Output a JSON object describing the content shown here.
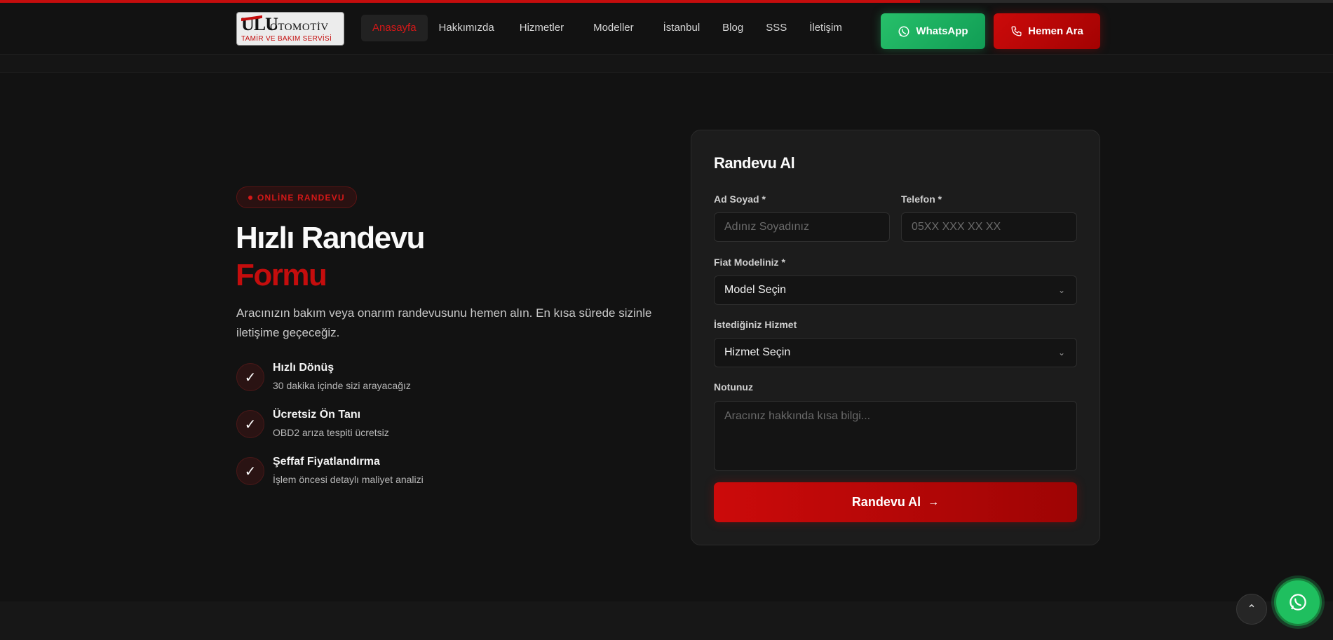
{
  "scroll_progress_percent": 69,
  "colors": {
    "accent": "#c40d0d",
    "whatsapp": "#1fbf5f",
    "background": "#121212"
  },
  "header": {
    "logo": {
      "mark": "ULU",
      "word": "OTOMOTİV",
      "subtitle": "TAMİR VE BAKIM SERVİSİ"
    },
    "nav": [
      {
        "label": "Anasayfa",
        "active": true
      },
      {
        "label": "Hakkımızda",
        "active": false
      },
      {
        "label": "Hizmetler",
        "active": false
      },
      {
        "label": "Modeller",
        "active": false
      },
      {
        "label": "İstanbul",
        "active": false
      },
      {
        "label": "Blog",
        "active": false
      },
      {
        "label": "SSS",
        "active": false
      },
      {
        "label": "İletişim",
        "active": false
      }
    ],
    "whatsapp_button": {
      "label": "WhatsApp",
      "icon": "whatsapp-icon"
    },
    "call_button": {
      "label": "Hemen Ara",
      "icon": "phone-icon"
    }
  },
  "hero": {
    "badge": "ONLİNE RANDEVU",
    "title_line1": "Hızlı Randevu",
    "title_line2": "Formu",
    "lead": "Aracınızın bakım veya onarım randevusunu hemen alın. En kısa sürede sizinle iletişime geçeceğiz.",
    "features": [
      {
        "title": "Hızlı Dönüş",
        "desc": "30 dakika içinde sizi arayacağız",
        "icon": "check-icon"
      },
      {
        "title": "Ücretsiz Ön Tanı",
        "desc": "OBD2 arıza tespiti ücretsiz",
        "icon": "check-icon"
      },
      {
        "title": "Şeffaf Fiyatlandırma",
        "desc": "İşlem öncesi detaylı maliyet analizi",
        "icon": "check-icon"
      }
    ]
  },
  "form": {
    "title": "Randevu Al",
    "name": {
      "label": "Ad Soyad *",
      "placeholder": "Adınız Soyadınız",
      "value": ""
    },
    "phone": {
      "label": "Telefon *",
      "placeholder": "05XX XXX XX XX",
      "value": ""
    },
    "model": {
      "label": "Fiat Modeliniz *",
      "selected": "Model Seçin"
    },
    "service": {
      "label": "İstediğiniz Hizmet",
      "selected": "Hizmet Seçin"
    },
    "note": {
      "label": "Notunuz",
      "placeholder": "Aracınız hakkında kısa bilgi...",
      "value": ""
    },
    "submit_label": "Randevu Al",
    "submit_icon": "arrow-right-icon"
  },
  "floating": {
    "back_to_top_icon": "chevron-up-icon",
    "whatsapp_icon": "whatsapp-icon"
  }
}
